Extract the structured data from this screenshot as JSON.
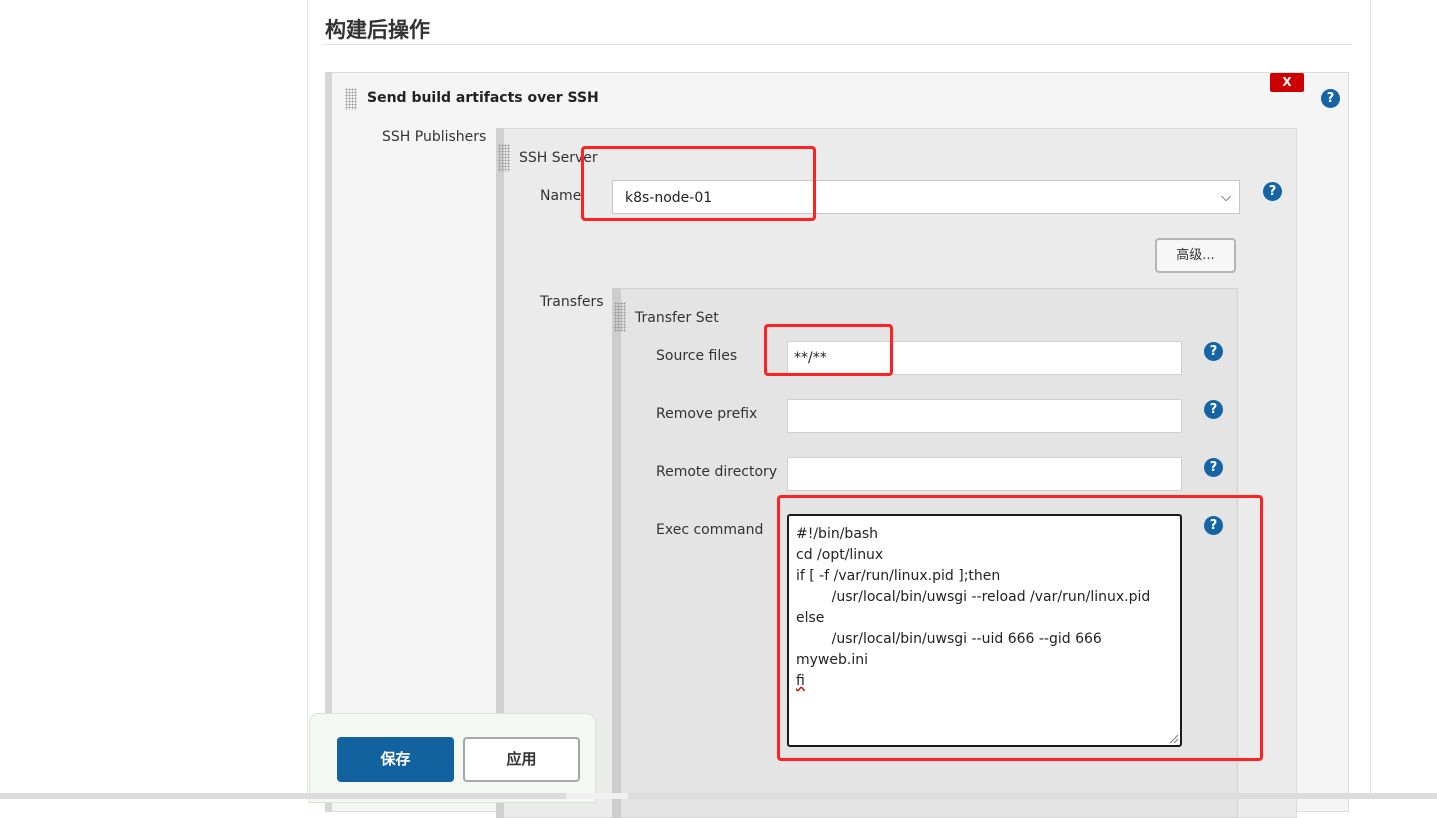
{
  "section": {
    "title": "构建后操作"
  },
  "publisher": {
    "title": "Send build artifacts over SSH",
    "delete_label": "X",
    "ssh_publishers_label": "SSH Publishers",
    "server": {
      "title": "SSH Server",
      "name_label": "Name",
      "name_value": "k8s-node-01",
      "advanced_label": "高级..."
    },
    "transfers_label": "Transfers",
    "transfer_set": {
      "title": "Transfer Set",
      "source_files_label": "Source files",
      "source_files_value": "**/**",
      "remove_prefix_label": "Remove prefix",
      "remove_prefix_value": "",
      "remote_directory_label": "Remote directory",
      "remote_directory_value": "",
      "exec_command_label": "Exec command",
      "exec_lines": [
        "#!/bin/bash",
        "cd /opt/linux",
        "if [ -f /var/run/linux.pid ];then",
        "        /usr/local/bin/uwsgi --reload /var/run/linux.pid",
        "else",
        "        /usr/local/bin/uwsgi --uid 666 --gid 666",
        "myweb.ini",
        "fi"
      ]
    }
  },
  "help_glyph": "?",
  "footer": {
    "save_label": "保存",
    "apply_label": "应用"
  },
  "colors": {
    "primary": "#11629f",
    "help": "#1565a6",
    "danger": "#cc0000",
    "highlight": "#ff2222"
  }
}
